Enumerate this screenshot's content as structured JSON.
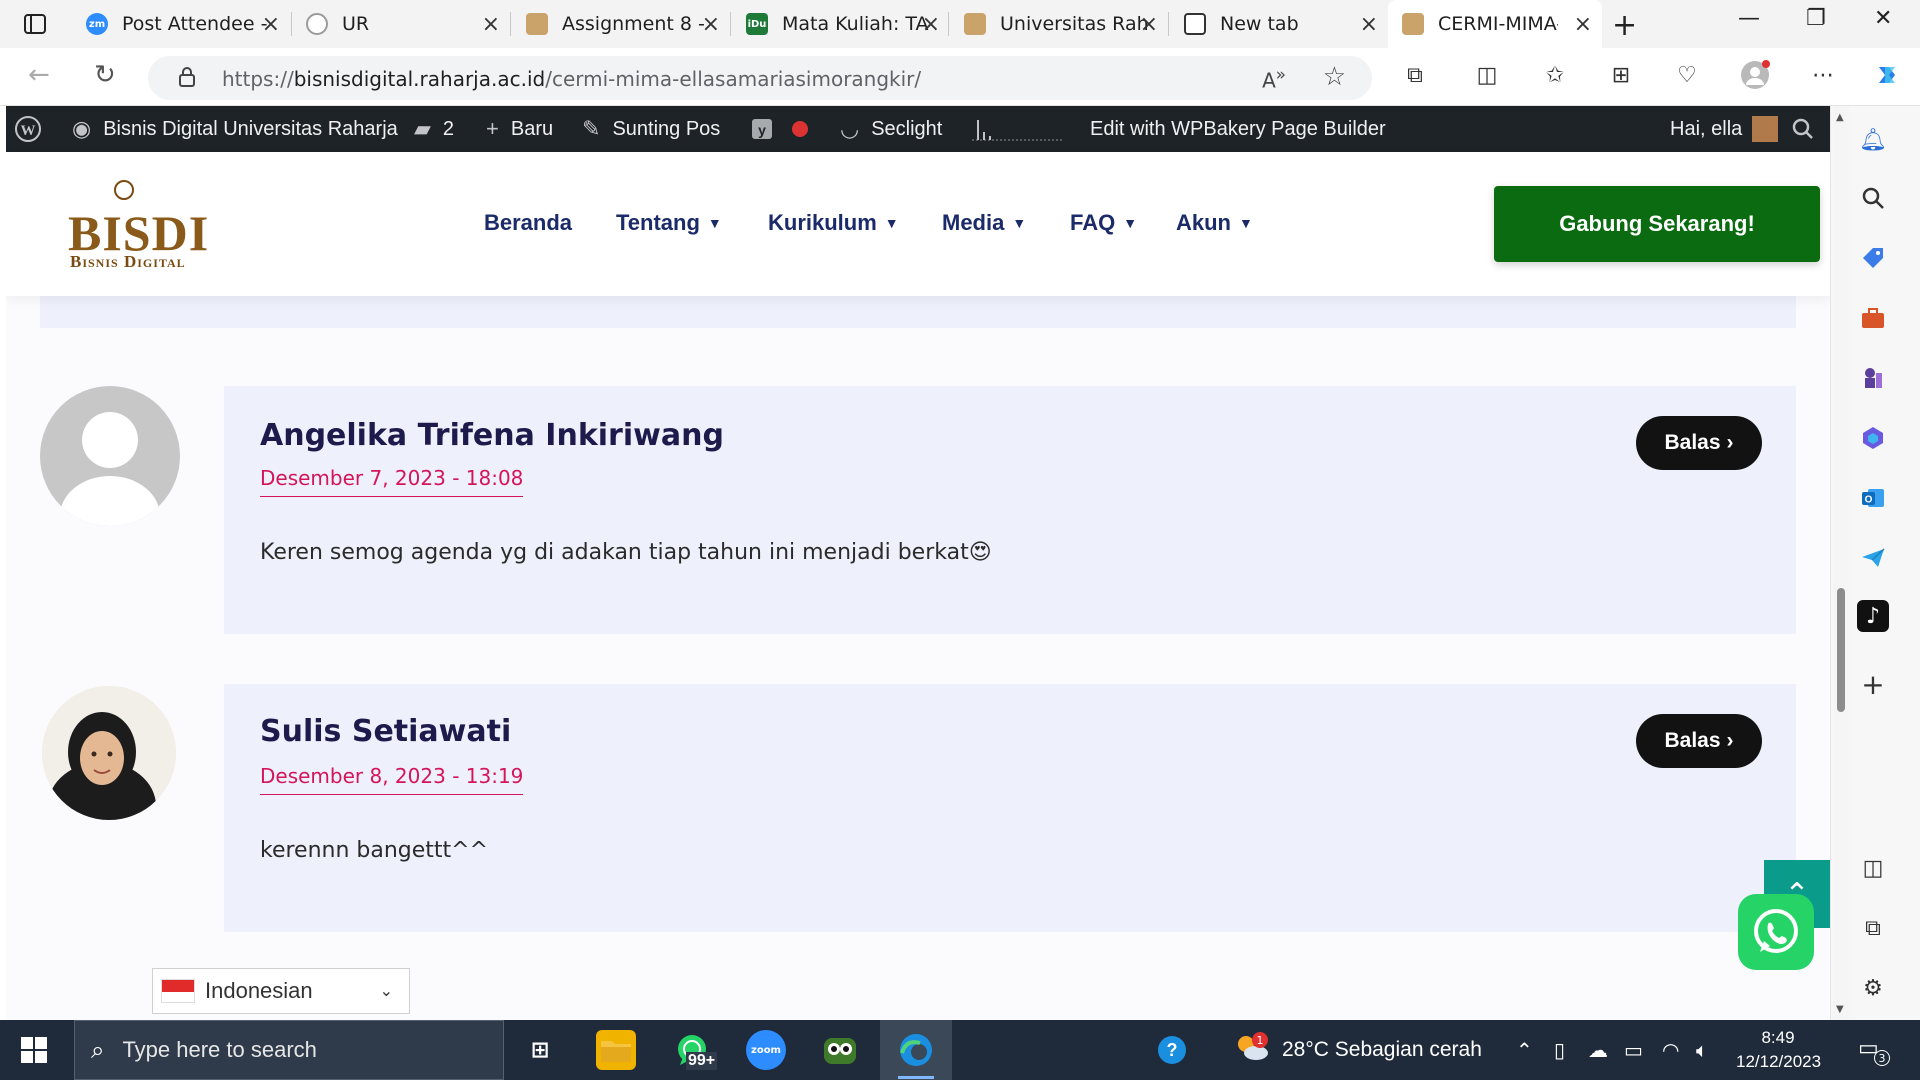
{
  "browser": {
    "tabs": [
      {
        "label": "Post Attendee -",
        "favicon": "zm",
        "color": "#2d8cff"
      },
      {
        "label": "UR",
        "favicon": "ur",
        "color": "#9b9b9b"
      },
      {
        "label": "Assignment 8 -",
        "favicon": "ur",
        "color": "#c9a36a"
      },
      {
        "label": "Mata Kuliah: TA",
        "favicon": "idu",
        "color": "#1f7a3a"
      },
      {
        "label": "Universitas Rah",
        "favicon": "ur",
        "color": "#c9a36a"
      },
      {
        "label": "New tab",
        "favicon": "newtab",
        "color": "#333333"
      },
      {
        "label": "CERMI-MIMA-E",
        "favicon": "ur",
        "color": "#c9a36a"
      }
    ],
    "url_prefix": "https://",
    "url_host": "bisnisdigital.raharja.ac.id",
    "url_path": "/cermi-mima-ellasamariasimorangkir/"
  },
  "admin_bar": {
    "site_name": "Bisnis Digital Universitas Raharja",
    "comments_count": "2",
    "new_label": "Baru",
    "edit_post_label": "Sunting Pos",
    "seclight_label": "Seclight",
    "wpbakery_label": "Edit with WPBakery Page Builder",
    "greeting": "Hai, ella"
  },
  "header": {
    "logo_text": "BISDI",
    "logo_subtext": "Bisnis Digital",
    "menu": [
      {
        "label": "Beranda",
        "has_dropdown": false
      },
      {
        "label": "Tentang",
        "has_dropdown": true
      },
      {
        "label": "Kurikulum",
        "has_dropdown": true
      },
      {
        "label": "Media",
        "has_dropdown": true
      },
      {
        "label": "FAQ",
        "has_dropdown": true
      },
      {
        "label": "Akun",
        "has_dropdown": true
      }
    ],
    "cta_label": "Gabung Sekarang!"
  },
  "comments": [
    {
      "author": "Angelika Trifena Inkiriwang",
      "date": "Desember 7, 2023 - 18:08",
      "text": "Keren semog agenda yg di adakan tiap tahun ini menjadi berkat😍",
      "reply_label": "Balas",
      "avatar": "default-avatar"
    },
    {
      "author": "Sulis Setiawati",
      "date": "Desember 8, 2023 - 13:19",
      "text": "kerennn bangettt^^",
      "reply_label": "Balas",
      "avatar": "photo-avatar"
    }
  ],
  "language_selector": {
    "selected": "Indonesian"
  },
  "taskbar": {
    "search_placeholder": "Type here to search",
    "whatsapp_badge": "99+",
    "zoom_label": "zoom",
    "weather": "28°C  Sebagian cerah",
    "weather_badge": "1",
    "time": "8:49",
    "date": "12/12/2023",
    "notification_count": "3"
  },
  "colors": {
    "admin_bar": "#1d2327",
    "menu_text": "#1b2a68",
    "cta": "#0a6b10",
    "comment_bg": "#eef0fb",
    "date_accent": "#d4155a",
    "reply_button": "#121212",
    "taskbar": "#1f2b3a"
  }
}
